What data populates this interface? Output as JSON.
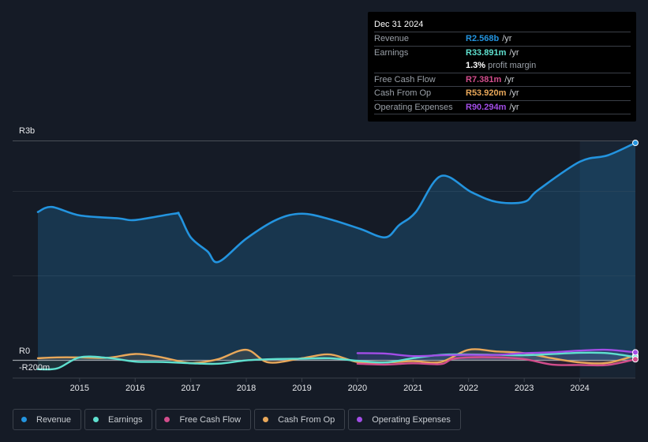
{
  "tooltip": {
    "date": "Dec 31 2024",
    "rows": [
      {
        "label": "Revenue",
        "value": "R2.568b",
        "unit": "/yr",
        "color": "#2394df"
      },
      {
        "label": "Earnings",
        "value": "R33.891m",
        "unit": "/yr",
        "color": "#5fe0cf"
      },
      {
        "label": "",
        "value": "1.3%",
        "unit": "profit margin",
        "color": "#ffffff"
      },
      {
        "label": "Free Cash Flow",
        "value": "R7.381m",
        "unit": "/yr",
        "color": "#d24d8c"
      },
      {
        "label": "Cash From Op",
        "value": "R53.920m",
        "unit": "/yr",
        "color": "#e9a85a"
      },
      {
        "label": "Operating Expenses",
        "value": "R90.294m",
        "unit": "/yr",
        "color": "#a24de6"
      }
    ]
  },
  "chart_data": {
    "type": "area",
    "title": "",
    "xlabel": "",
    "ylabel": "",
    "y_tick_labels": [
      "R3b",
      "R0",
      "-R200m"
    ],
    "x_tick_labels": [
      "2015",
      "2016",
      "2017",
      "2018",
      "2019",
      "2020",
      "2021",
      "2022",
      "2023",
      "2024"
    ],
    "xlim": [
      2014.25,
      2025.0
    ],
    "ylim": [
      -200,
      2568
    ],
    "grid": true,
    "highlight_start": 2024.0,
    "legend_position": "bottom",
    "series": [
      {
        "name": "Revenue",
        "color": "#2394df",
        "x": [
          2014.25,
          2014.5,
          2015.0,
          2015.7,
          2016.0,
          2016.7,
          2016.8,
          2017.0,
          2017.3,
          2017.5,
          2018.0,
          2018.55,
          2019.0,
          2019.5,
          2020.05,
          2020.5,
          2020.75,
          2021.05,
          2021.5,
          2022.05,
          2022.5,
          2023.0,
          2023.25,
          2024.0,
          2024.5,
          2025.0
        ],
        "values": [
          1750,
          1810,
          1710,
          1675,
          1655,
          1730,
          1710,
          1450,
          1285,
          1160,
          1435,
          1660,
          1730,
          1665,
          1550,
          1450,
          1595,
          1750,
          2175,
          1985,
          1870,
          1870,
          2010,
          2345,
          2420,
          2568
        ]
      },
      {
        "name": "Earnings",
        "color": "#5fe0cf",
        "x": [
          2014.25,
          2014.6,
          2015.0,
          2015.5,
          2016.0,
          2016.5,
          2017.0,
          2017.5,
          2018.0,
          2018.5,
          2019.0,
          2019.5,
          2020.0,
          2020.5,
          2021.0,
          2021.5,
          2022.0,
          2022.5,
          2023.0,
          2023.5,
          2024.0,
          2024.5,
          2025.0
        ],
        "values": [
          -110,
          -100,
          30,
          25,
          -20,
          -25,
          -40,
          -45,
          -5,
          10,
          15,
          20,
          -10,
          -30,
          20,
          60,
          65,
          60,
          55,
          70,
          85,
          80,
          34
        ]
      },
      {
        "name": "Free Cash Flow",
        "color": "#d24d8c",
        "x": [
          2020.0,
          2020.5,
          2021.0,
          2021.5,
          2021.7,
          2022.0,
          2022.5,
          2023.0,
          2023.5,
          2024.0,
          2024.5,
          2025.0
        ],
        "values": [
          -45,
          -55,
          -40,
          -50,
          10,
          30,
          30,
          10,
          -55,
          -60,
          -60,
          7
        ]
      },
      {
        "name": "Cash From Op",
        "color": "#e9a85a",
        "x": [
          2014.25,
          2014.6,
          2015.0,
          2015.5,
          2016.0,
          2016.4,
          2016.9,
          2017.1,
          2017.5,
          2018.0,
          2018.4,
          2019.0,
          2019.5,
          2020.0,
          2020.5,
          2021.0,
          2021.5,
          2022.0,
          2022.5,
          2023.0,
          2023.5,
          2024.0,
          2024.5,
          2025.0
        ],
        "values": [
          20,
          30,
          30,
          25,
          70,
          40,
          -30,
          -35,
          10,
          120,
          -30,
          20,
          65,
          -25,
          -30,
          -15,
          -25,
          120,
          100,
          80,
          20,
          -30,
          -35,
          54
        ]
      },
      {
        "name": "Operating Expenses",
        "color": "#a24de6",
        "x": [
          2020.0,
          2020.5,
          2021.0,
          2021.5,
          2022.0,
          2022.5,
          2023.0,
          2023.5,
          2024.0,
          2024.5,
          2025.0
        ],
        "values": [
          80,
          75,
          45,
          55,
          60,
          60,
          80,
          90,
          110,
          120,
          90
        ]
      }
    ]
  },
  "legend": [
    {
      "label": "Revenue",
      "color": "#2394df"
    },
    {
      "label": "Earnings",
      "color": "#5fe0cf"
    },
    {
      "label": "Free Cash Flow",
      "color": "#d24d8c"
    },
    {
      "label": "Cash From Op",
      "color": "#e9a85a"
    },
    {
      "label": "Operating Expenses",
      "color": "#a24de6"
    }
  ]
}
